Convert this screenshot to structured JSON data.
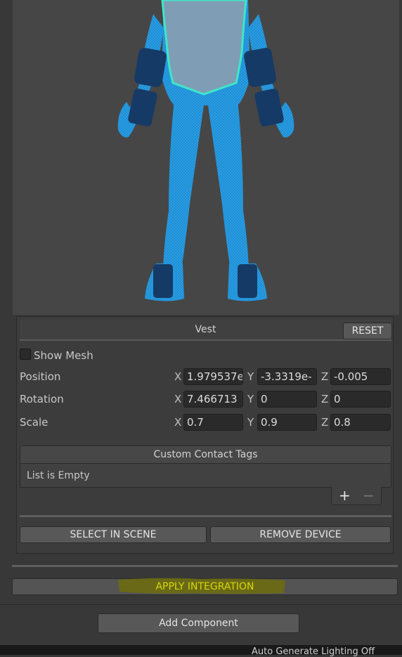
{
  "device_panel": {
    "title": "Vest",
    "reset_label": "RESET",
    "show_mesh_label": "Show Mesh",
    "show_mesh_checked": false,
    "transform": {
      "position": {
        "label": "Position",
        "x": "1.979537e",
        "y": "-3.3319e-",
        "z": "-0.005"
      },
      "rotation": {
        "label": "Rotation",
        "x": "7.466713",
        "y": "0",
        "z": "0"
      },
      "scale": {
        "label": "Scale",
        "x": "0.7",
        "y": "0.9",
        "z": "0.8"
      },
      "axis_x": "X",
      "axis_y": "Y",
      "axis_z": "Z"
    },
    "custom_contact_tags": {
      "header": "Custom Contact Tags",
      "empty_text": "List is Empty",
      "add_label": "+",
      "remove_label": "−"
    },
    "select_in_scene_label": "SELECT IN SCENE",
    "remove_device_label": "REMOVE DEVICE"
  },
  "apply_integration_label": "APPLY INTEGRATION",
  "add_component_label": "Add Component",
  "status_bar": {
    "text": "Auto Generate Lighting Off"
  },
  "colors": {
    "body_mesh": "#1e8fd6",
    "vest_fill": "#7f9db5",
    "vest_outline": "#3fe6c8",
    "pads": "#163a66",
    "highlight": "#d8d800"
  }
}
